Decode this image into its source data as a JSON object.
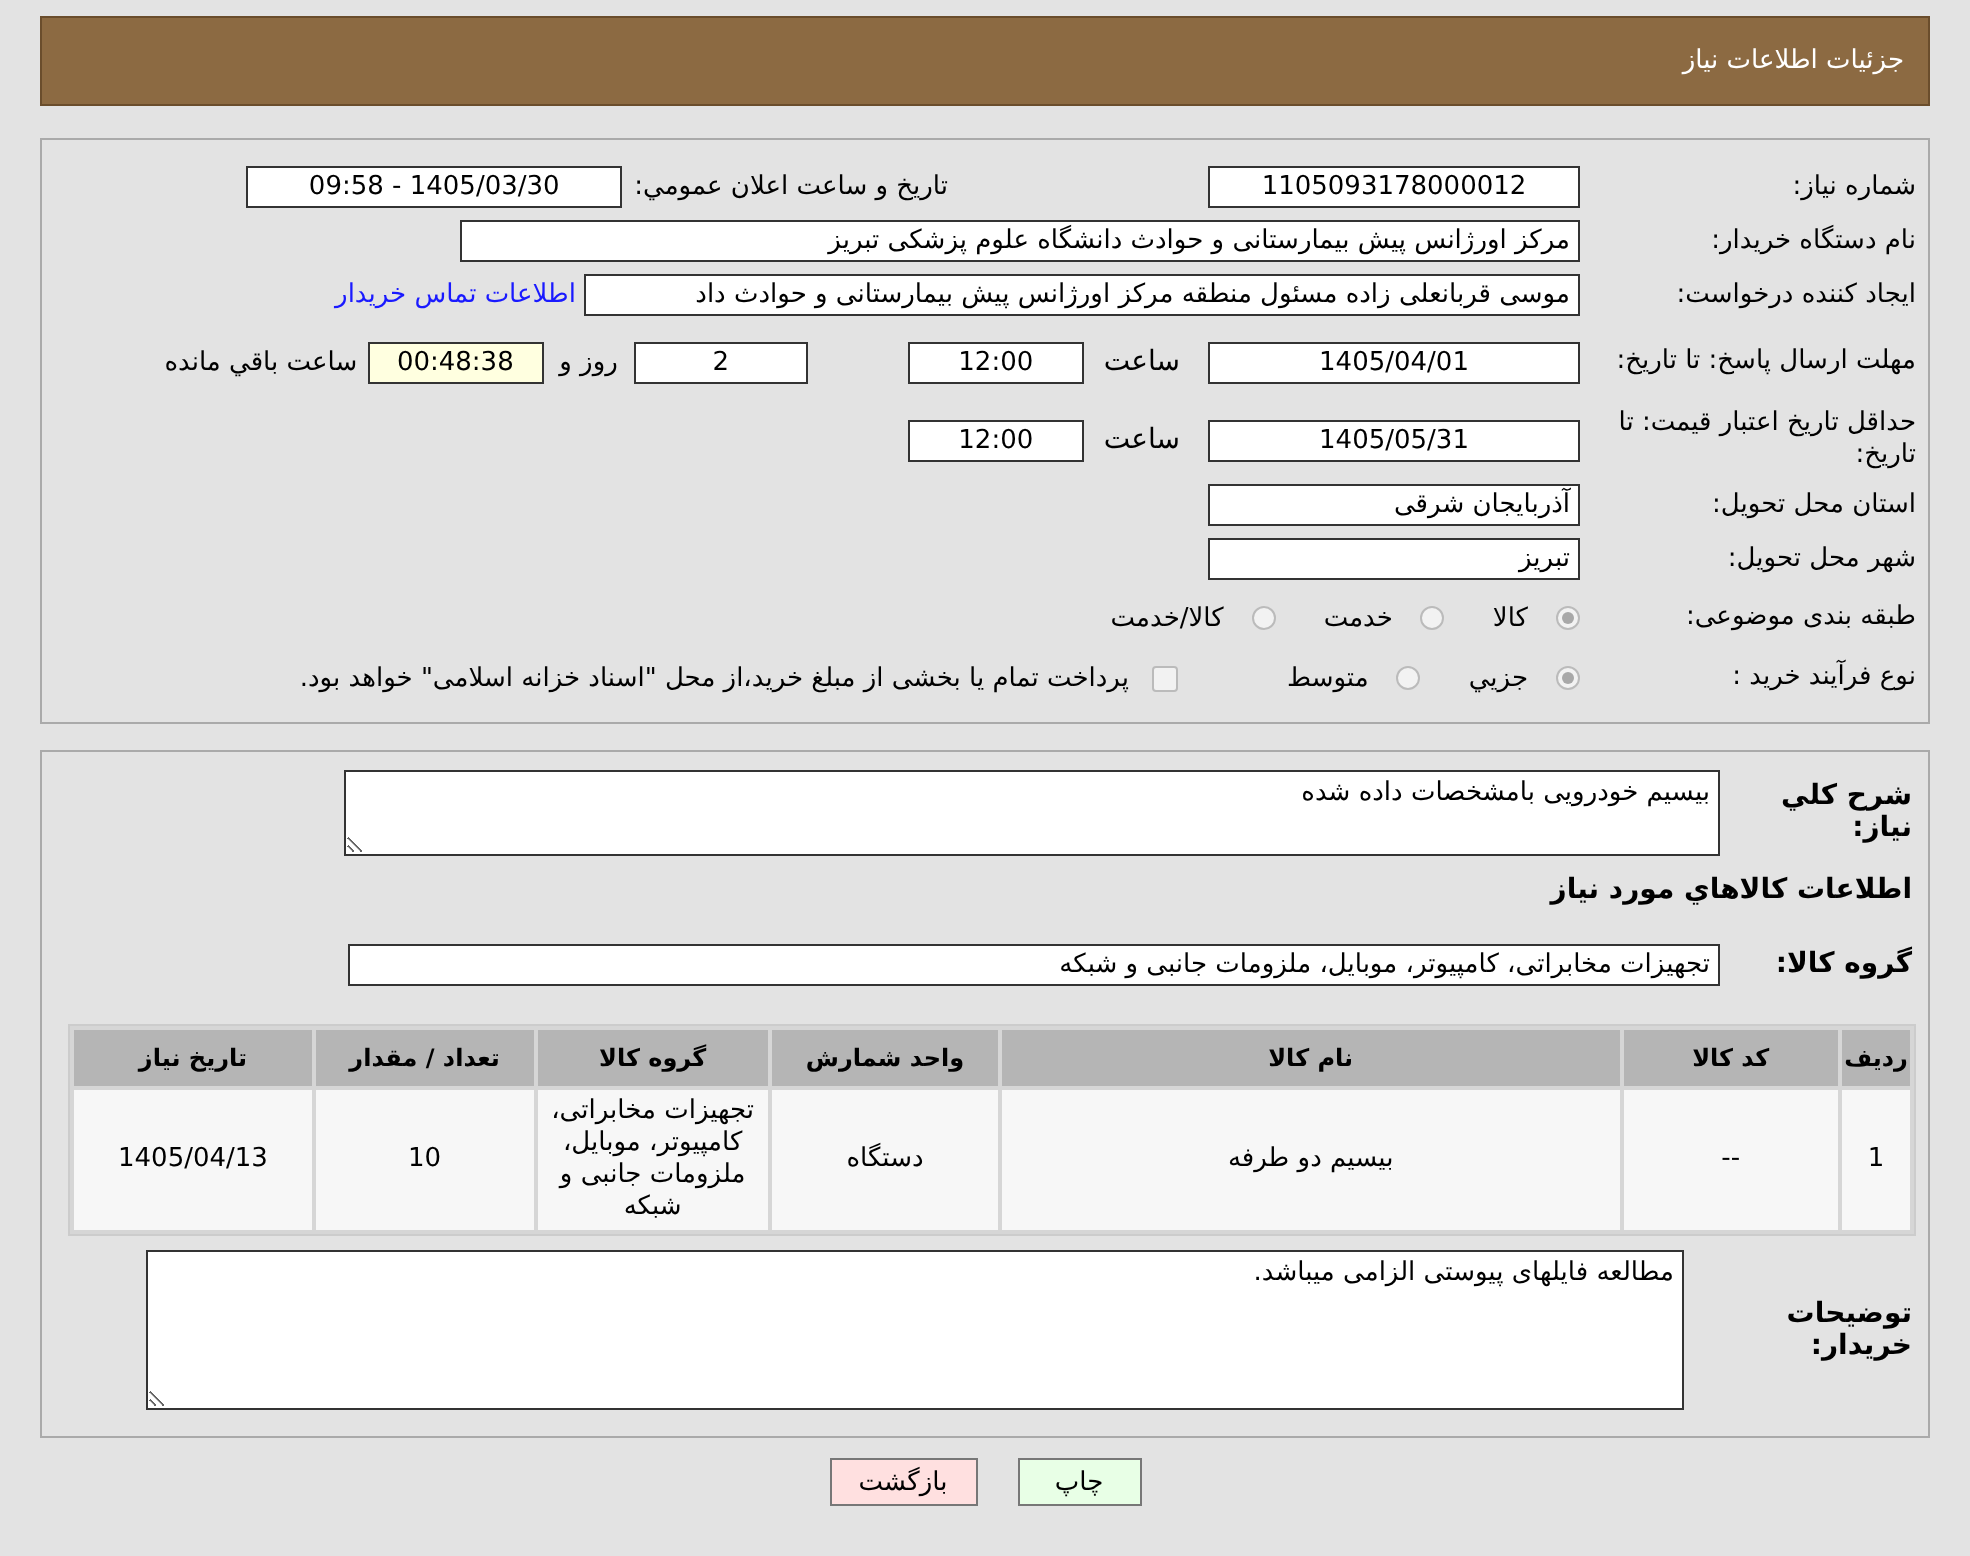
{
  "header": {
    "title": "جزئیات اطلاعات نیاز"
  },
  "need_number": {
    "label": "شماره نیاز:",
    "value": "1105093178000012"
  },
  "announce": {
    "label": "تاریخ و ساعت اعلان عمومي:",
    "value": "1405/03/30 - 09:58"
  },
  "buyer": {
    "label": "نام دستگاه خریدار:",
    "value": "مرکز اورژانس پیش بیمارستانی و حوادث دانشگاه علوم پزشکی تبریز"
  },
  "requester": {
    "label": "ایجاد کننده درخواست:",
    "value": "موسی قربانعلی زاده مسئول منطقه مرکز اورژانس پیش بیمارستانی و حوادث داد",
    "link": "اطلاعات تماس خریدار"
  },
  "deadline": {
    "label": "مهلت ارسال پاسخ: تا تاریخ:",
    "date": "1405/04/01",
    "time_label": "ساعت",
    "time": "12:00",
    "days": "2",
    "days_label": "روز و",
    "remaining": "00:48:38",
    "remaining_label": "ساعت باقي مانده"
  },
  "validity": {
    "label": "حداقل تاریخ اعتبار قیمت: تا تاریخ:",
    "date": "1405/05/31",
    "time_label": "ساعت",
    "time": "12:00"
  },
  "province": {
    "label": "استان محل تحویل:",
    "value": "آذربایجان شرقی"
  },
  "city": {
    "label": "شهر محل تحویل:",
    "value": "تبریز"
  },
  "category": {
    "label": "طبقه بندی موضوعی:",
    "options": [
      {
        "label": "کالا",
        "selected": true
      },
      {
        "label": "خدمت",
        "selected": false
      },
      {
        "label": "کالا/خدمت",
        "selected": false
      }
    ]
  },
  "process": {
    "label": "نوع فرآیند خرید :",
    "options": [
      {
        "label": "جزيي",
        "selected": true
      },
      {
        "label": "متوسط",
        "selected": false
      }
    ],
    "payment": {
      "label": "پرداخت تمام یا بخشی از مبلغ خرید،از محل \"اسناد خزانه اسلامی\" خواهد بود.",
      "checked": false
    }
  },
  "description": {
    "label": "شرح کلي نياز:",
    "value": "بیسیم خودرویی بامشخصات داده شده"
  },
  "goods_title": "اطلاعات کالاهاي مورد نياز",
  "goods_group": {
    "label": "گروه کالا:",
    "value": "تجهیزات مخابراتی، کامپیوتر، موبایل، ملزومات جانبی و شبکه"
  },
  "table": {
    "columns": [
      "ردیف",
      "کد کالا",
      "نام کالا",
      "واحد شمارش",
      "گروه کالا",
      "تعداد / مقدار",
      "تاریخ نیاز"
    ],
    "rows": [
      [
        "1",
        "--",
        "بیسیم دو طرفه",
        "دستگاه",
        "تجهیزات مخابراتی، کامپیوتر، موبایل، ملزومات جانبی و شبکه",
        "10",
        "1405/04/13"
      ]
    ]
  },
  "notes": {
    "label": "توضیحات خریدار:",
    "value": "مطالعه فایلهای پیوستی الزامی میباشد."
  },
  "buttons": [
    {
      "label": "چاپ",
      "kind": "print"
    },
    {
      "label": "بازگشت",
      "kind": "back"
    }
  ]
}
